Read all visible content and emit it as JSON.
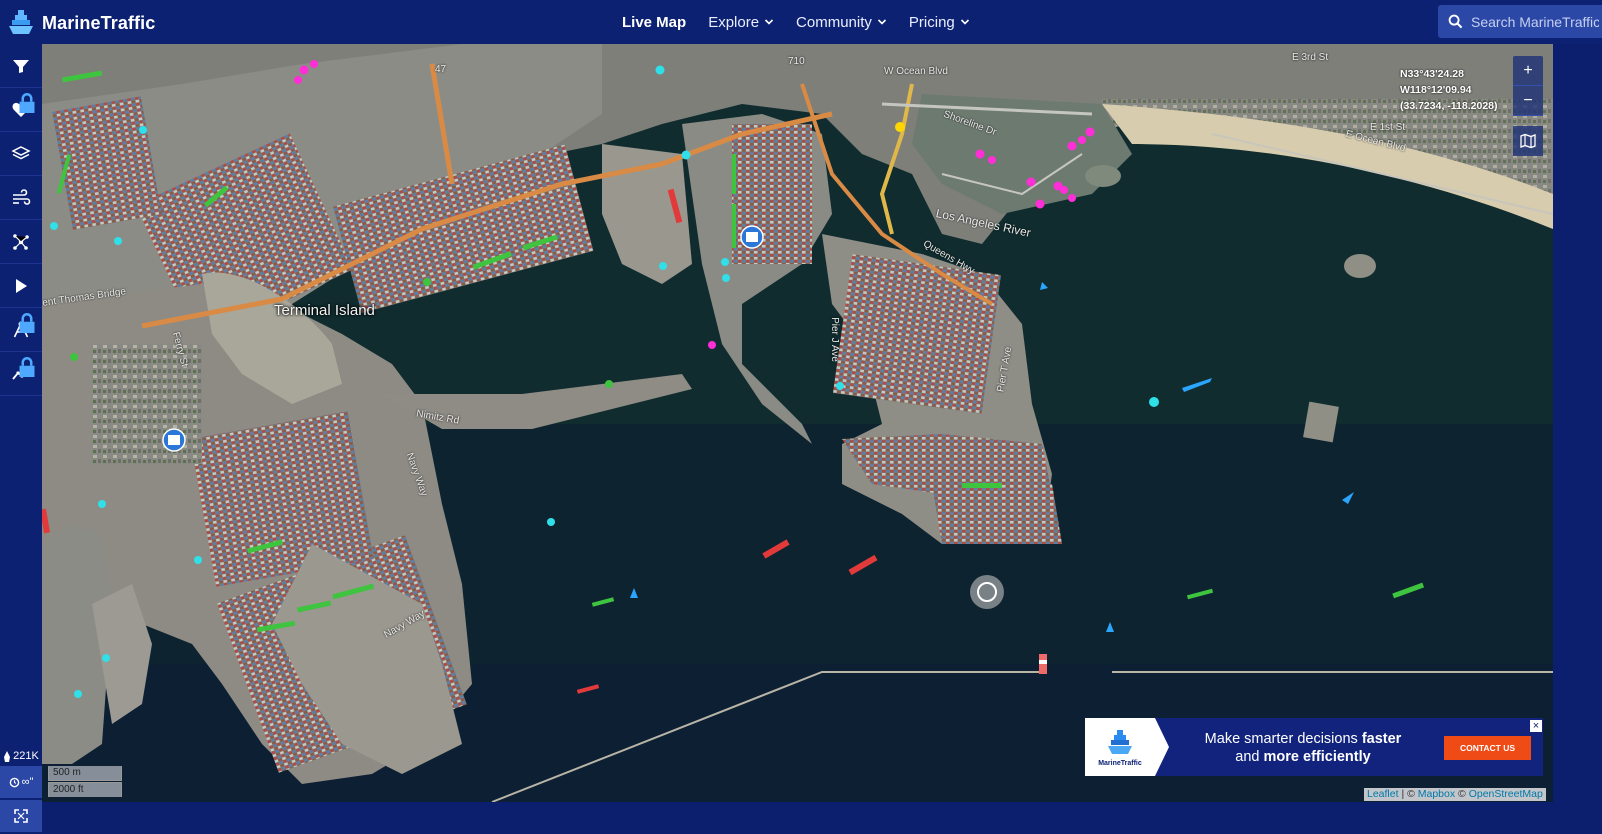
{
  "app": {
    "name": "MarineTraffic"
  },
  "nav": {
    "live_map": "Live Map",
    "explore": "Explore",
    "community": "Community",
    "pricing": "Pricing"
  },
  "search": {
    "placeholder": "Search MarineTraffic"
  },
  "sidebar": {
    "items": [
      {
        "name": "filters",
        "icon": "filter-icon",
        "locked": false
      },
      {
        "name": "my-fleets",
        "icon": "heart-icon",
        "locked": true
      },
      {
        "name": "layers",
        "icon": "layers-icon",
        "locked": false
      },
      {
        "name": "weather",
        "icon": "wind-icon",
        "locked": false
      },
      {
        "name": "density",
        "icon": "network-icon",
        "locked": false
      },
      {
        "name": "playback",
        "icon": "play-icon",
        "locked": false
      },
      {
        "name": "measure",
        "icon": "compass-icon",
        "locked": true
      },
      {
        "name": "analytics",
        "icon": "chart-line-icon",
        "locked": true
      }
    ],
    "vessel_count": "221K",
    "timeline_label": "∞\""
  },
  "map": {
    "labels": {
      "terminal_island": "Terminal Island",
      "los_angeles_river": "Los Angeles River",
      "ocean_blvd": "W Ocean Blvd",
      "shoreline_dr": "Shoreline Dr",
      "queens_hwy": "Queens Hwy",
      "e_ocean_blvd": "E Ocean Blvd",
      "e_first_st": "E 1st St",
      "e_third_st": "E 3rd St",
      "navy_way_1": "Navy Way",
      "navy_way_2": "Navy Way",
      "nimitz_rd": "Nimitz Rd",
      "pier_400": "Pier J Ave",
      "thomas_bridge": "ent Thomas Bridge",
      "ferry_st": "Ferry St",
      "hwy_47": "47",
      "hwy_710": "710",
      "harbor_pl": "Pier T Ave"
    },
    "coordinates": {
      "lat": "N33°43'24.28",
      "lon": "W118°12'09.94",
      "decimal": "(33.7234, -118.2028)"
    },
    "zoom_in": "+",
    "zoom_out": "−",
    "scale": {
      "metric": "500 m",
      "imperial": "2000 ft"
    },
    "attribution": {
      "leaflet": "Leaflet",
      "sep1": " | © ",
      "mapbox": "Mapbox",
      "sep2": " © ",
      "osm": "OpenStreetMap"
    }
  },
  "ad": {
    "line1_normal": "Make smarter decisions ",
    "line1_bold": "faster",
    "line2_normal": "and ",
    "line2_bold": "more efficiently",
    "cta": "CONTACT US",
    "logo_text": "MarineTraffic",
    "close": "×"
  },
  "colors": {
    "brand_navy": "#0c2172",
    "cta_orange": "#ef4b16",
    "vessel_cargo": "#3ec43e",
    "vessel_tanker": "#e23a3a",
    "vessel_passenger": "#2aa6ff",
    "vessel_pleasure": "#ff2ed6",
    "vessel_tug": "#27e0e8"
  }
}
